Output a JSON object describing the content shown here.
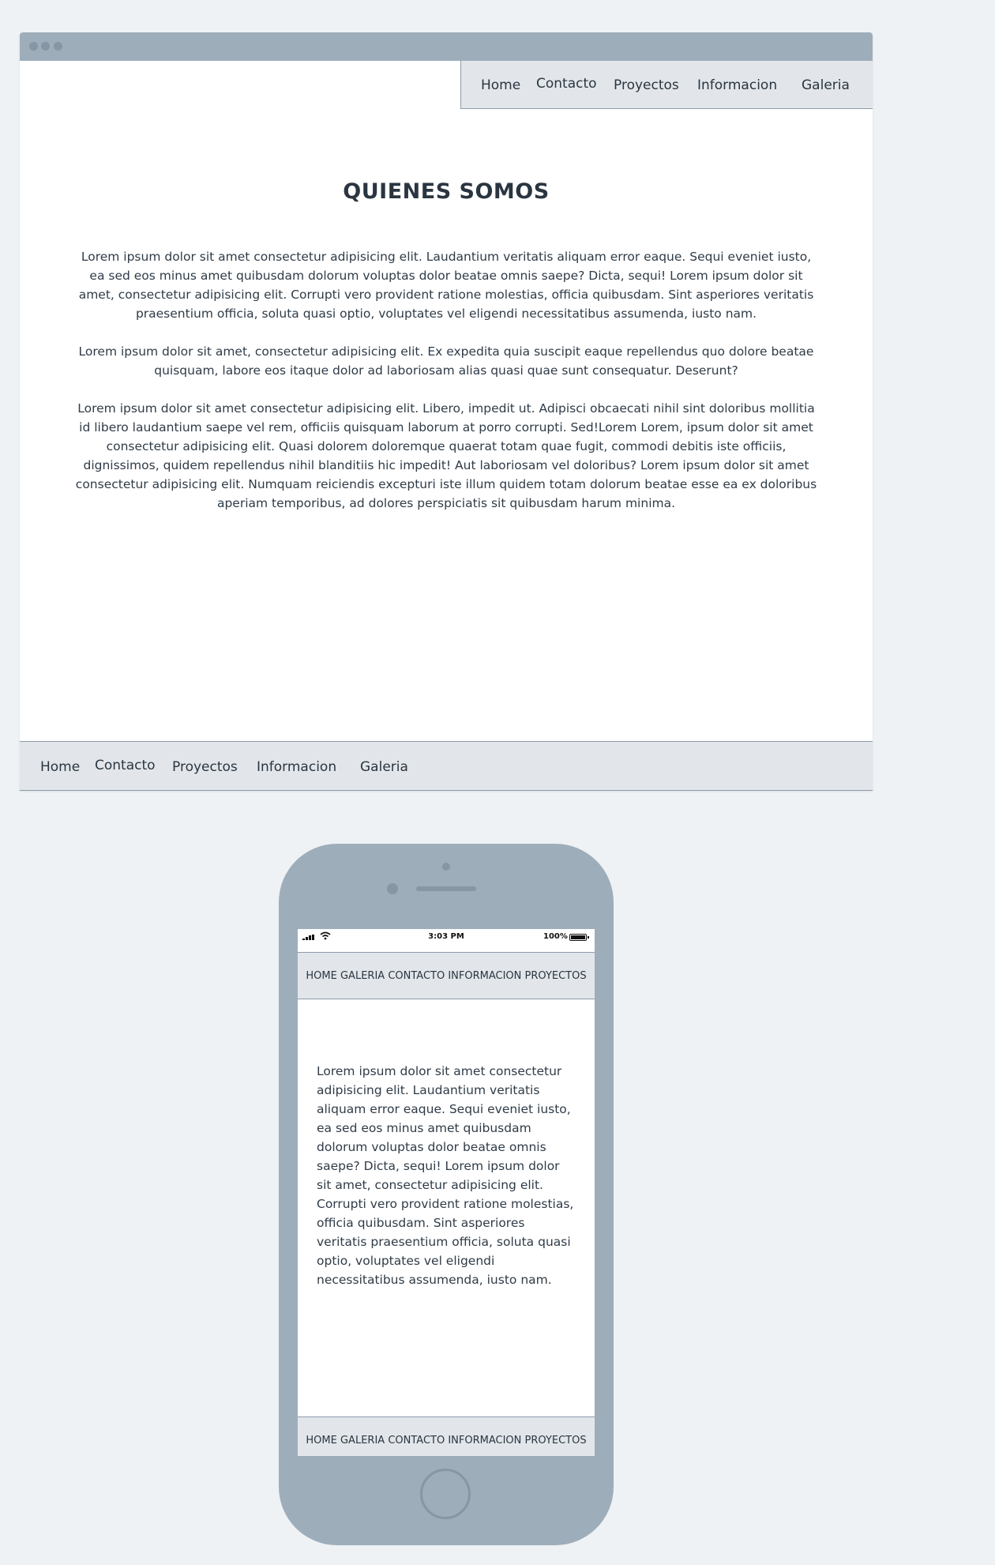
{
  "desktop": {
    "top_nav": {
      "items": [
        "Home",
        "Contacto",
        "Proyectos",
        "Informacion",
        "Galeria"
      ]
    },
    "title": "QUIENES SOMOS",
    "paragraphs": [
      "Lorem ipsum dolor sit amet consectetur adipisicing elit. Laudantium veritatis aliquam error eaque. Sequi eveniet iusto, ea sed eos minus amet quibusdam dolorum voluptas dolor beatae omnis saepe? Dicta, sequi! Lorem ipsum dolor sit amet, consectetur adipisicing elit. Corrupti vero provident ratione molestias, officia quibusdam. Sint asperiores veritatis praesentium officia, soluta quasi optio, voluptates vel eligendi necessitatibus assumenda, iusto nam.",
      "Lorem ipsum dolor sit amet, consectetur adipisicing elit. Ex expedita quia suscipit eaque repellendus quo dolore beatae quisquam, labore eos itaque dolor ad laboriosam alias quasi quae sunt consequatur. Deserunt?",
      "Lorem ipsum dolor sit amet consectetur adipisicing elit. Libero, impedit ut. Adipisci obcaecati nihil sint doloribus mollitia id libero laudantium saepe vel rem, officiis quisquam laborum at porro corrupti. Sed!Lorem Lorem, ipsum dolor sit amet consectetur adipisicing elit. Quasi dolorem doloremque quaerat totam quae fugit, commodi debitis iste officiis, dignissimos, quidem repellendus nihil blanditiis hic impedit! Aut laboriosam vel doloribus? Lorem ipsum dolor sit amet consectetur adipisicing elit. Numquam reiciendis excepturi iste illum quidem totam dolorum beatae esse ea ex doloribus aperiam temporibus, ad dolores perspiciatis sit quibusdam harum minima."
    ],
    "bottom_nav": {
      "items": [
        "Home",
        "Contacto",
        "Proyectos",
        "Informacion",
        "Galeria"
      ]
    }
  },
  "mobile": {
    "status_bar": {
      "time": "3:03 PM",
      "battery": "100%",
      "icons": [
        "signal-icon",
        "wifi-icon",
        "battery-icon"
      ]
    },
    "top_nav": {
      "items": [
        "HOME",
        "GALERIA",
        "CONTACTO",
        "INFORMACION",
        "PROYECTOS"
      ]
    },
    "paragraph": "Lorem ipsum dolor sit amet consectetur adipisicing elit. Laudantium veritatis aliquam error eaque. Sequi eveniet iusto, ea sed eos minus amet quibusdam dolorum voluptas dolor beatae omnis saepe? Dicta, sequi! Lorem ipsum dolor sit amet, consectetur adipisicing elit. Corrupti vero provident ratione molestias, officia quibusdam. Sint asperiores veritatis praesentium officia, soluta quasi optio, voluptates vel eligendi necessitatibus assumenda, iusto nam.",
    "bottom_nav": {
      "items": [
        "HOME",
        "GALERIA",
        "CONTACTO",
        "INFORMACION",
        "PROYECTOS"
      ]
    }
  },
  "colors": {
    "page_background": "#eef2f5",
    "frame": "#9eadba",
    "nav_background": "#e2e6ea",
    "text": "#2a3540"
  }
}
